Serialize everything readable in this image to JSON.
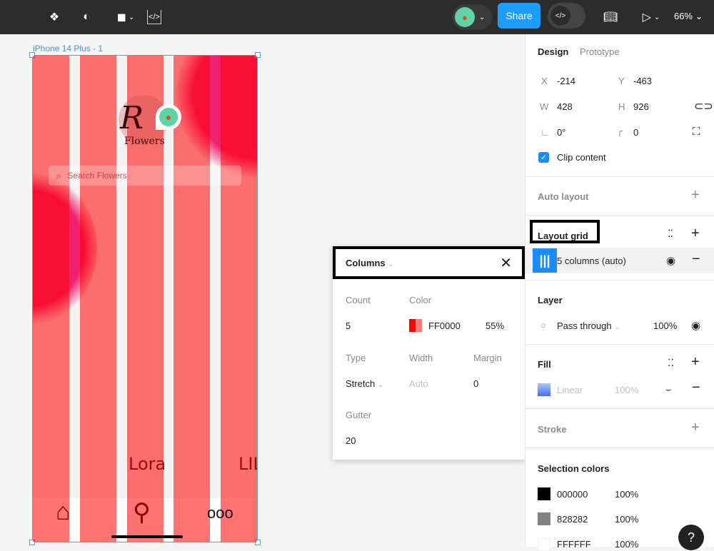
{
  "toolbar": {
    "share_label": "Share",
    "zoom_level": "66%",
    "icons": [
      "component-icon",
      "contrast-icon",
      "shape-icon",
      "code-frame-icon",
      "avatar-icon",
      "dev-mode-icon",
      "library-book-icon",
      "play-icon"
    ]
  },
  "canvas": {
    "frame_label": "iPhone 14 Plus - 1",
    "logo_initial": "R",
    "logo_text": "Flowers",
    "search_placeholder": "Search Flowers",
    "flower_labels": [
      "Lora",
      "LIL"
    ]
  },
  "popup": {
    "title": "Columns",
    "count_label": "Count",
    "count_value": "5",
    "color_label": "Color",
    "color_hex": "FF0000",
    "color_opacity": "55%",
    "type_label": "Type",
    "type_value": "Stretch",
    "width_label": "Width",
    "width_value": "Auto",
    "margin_label": "Margin",
    "margin_value": "0",
    "gutter_label": "Gutter",
    "gutter_value": "20"
  },
  "panel": {
    "tabs": [
      "Design",
      "Prototype"
    ],
    "x_label": "X",
    "x_value": "-214",
    "y_label": "Y",
    "y_value": "-463",
    "w_label": "W",
    "w_value": "428",
    "h_label": "H",
    "h_value": "926",
    "rotation": "0°",
    "radius": "0",
    "clip_content": "Clip content",
    "auto_layout": "Auto layout",
    "layout_grid": "Layout grid",
    "grid_item": "5 columns (auto)",
    "layer": "Layer",
    "blend_mode": "Pass through",
    "layer_opacity": "100%",
    "fill": "Fill",
    "fill_type": "Linear",
    "fill_opacity": "100%",
    "stroke": "Stroke",
    "selection_colors": "Selection colors",
    "colors": [
      {
        "hex": "000000",
        "opacity": "100%",
        "swatch": "#000000"
      },
      {
        "hex": "828282",
        "opacity": "100%",
        "swatch": "#828282"
      },
      {
        "hex": "FFFFFF",
        "opacity": "100%",
        "swatch": "#FFFFFF"
      }
    ],
    "help": "?"
  }
}
